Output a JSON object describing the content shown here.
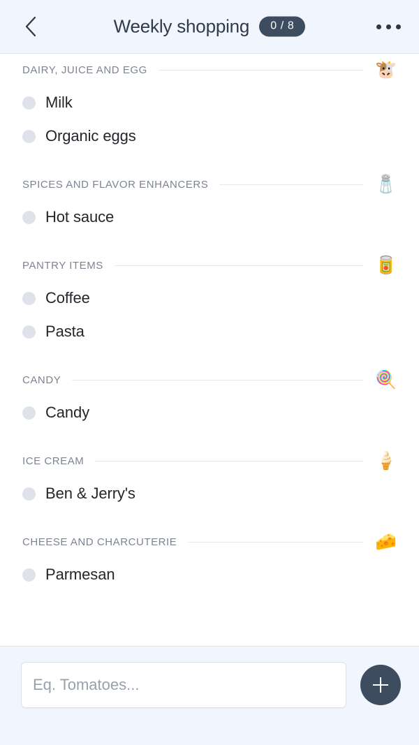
{
  "header": {
    "back_icon": "chevron-left-icon",
    "title": "Weekly shopping",
    "count_badge": "0 / 8",
    "menu_icon": "overflow-menu-icon",
    "background_color": "#f1f5fd",
    "badge_color": "#3e4c60",
    "title_color": "#2f3b4d"
  },
  "sections": [
    {
      "title": "DAIRY, JUICE AND EGG",
      "emoji": "🐮",
      "emoji_name": "cow-face-emoji",
      "items": [
        {
          "label": "Milk",
          "checked": false
        },
        {
          "label": "Organic eggs",
          "checked": false
        }
      ]
    },
    {
      "title": "SPICES AND FLAVOR ENHANCERS",
      "emoji": "🧂",
      "emoji_name": "salt-shaker-emoji",
      "items": [
        {
          "label": "Hot sauce",
          "checked": false
        }
      ]
    },
    {
      "title": "PANTRY ITEMS",
      "emoji": "🥫",
      "emoji_name": "canned-food-emoji",
      "items": [
        {
          "label": "Coffee",
          "checked": false
        },
        {
          "label": "Pasta",
          "checked": false
        }
      ]
    },
    {
      "title": "CANDY",
      "emoji": "🍭",
      "emoji_name": "lollipop-emoji",
      "items": [
        {
          "label": "Candy",
          "checked": false
        }
      ]
    },
    {
      "title": "ICE CREAM",
      "emoji": "🍦",
      "emoji_name": "soft-ice-cream-emoji",
      "items": [
        {
          "label": "Ben & Jerry's",
          "checked": false
        }
      ]
    },
    {
      "title": "CHEESE AND CHARCUTERIE",
      "emoji": "🧀",
      "emoji_name": "cheese-wedge-emoji",
      "items": [
        {
          "label": "Parmesan",
          "checked": false
        }
      ]
    }
  ],
  "bottom_bar": {
    "input_value": "",
    "input_placeholder": "Eq. Tomatoes...",
    "add_button_icon": "plus-icon",
    "add_button_color": "#3e4c60",
    "background_color": "#f1f5fd"
  }
}
